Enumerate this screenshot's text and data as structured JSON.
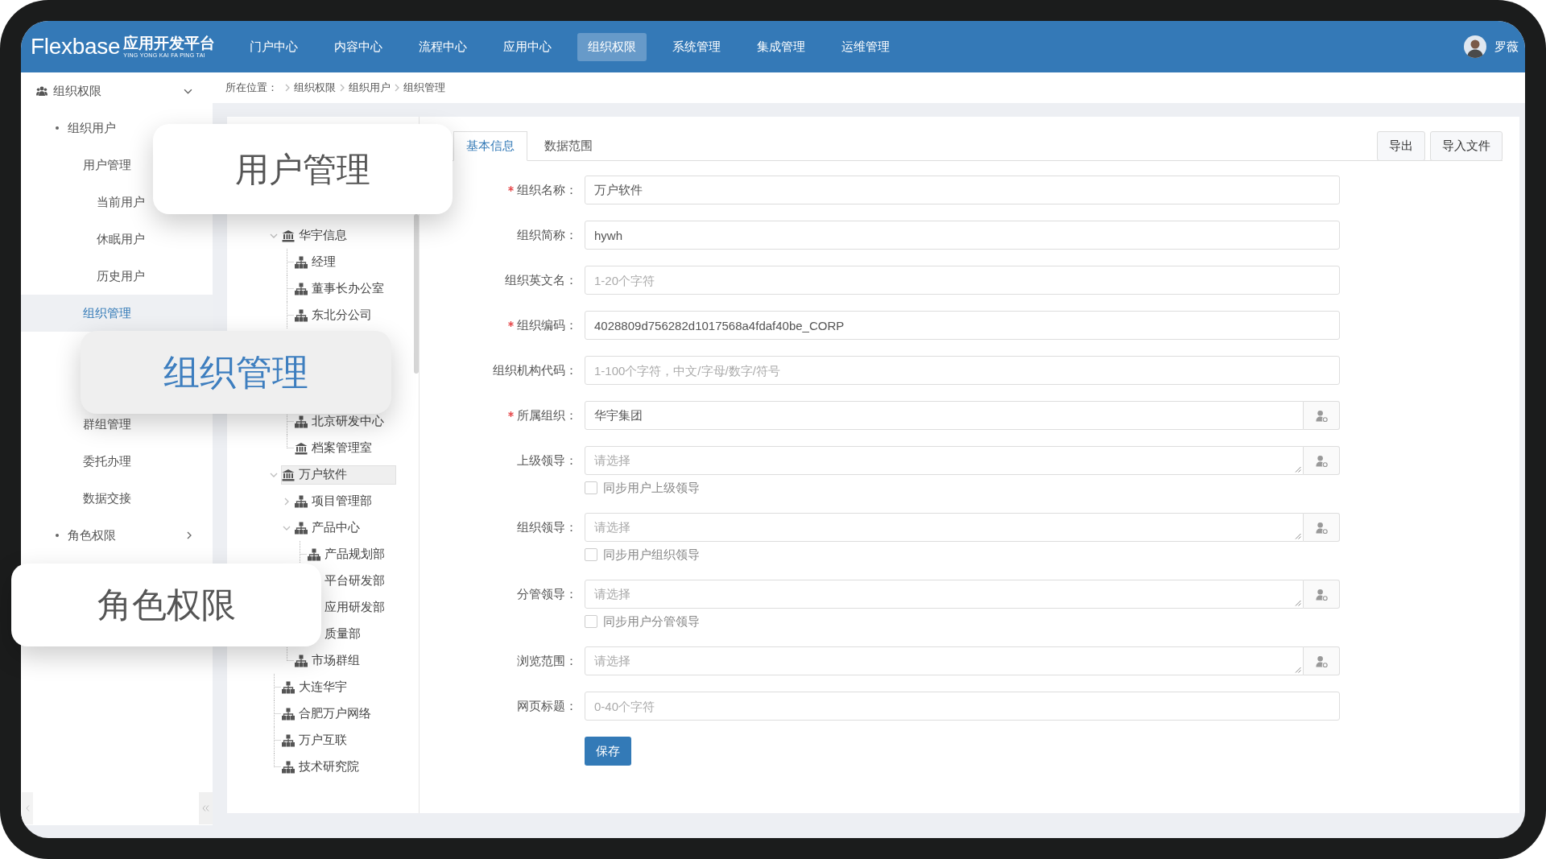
{
  "header": {
    "logo": {
      "wordmark": "Flexbase",
      "title": "应用开发平台",
      "subtitle": "YING YONG KAI FA PING TAI"
    },
    "nav": [
      {
        "label": "门户中心",
        "selected": false
      },
      {
        "label": "内容中心",
        "selected": false
      },
      {
        "label": "流程中心",
        "selected": false
      },
      {
        "label": "应用中心",
        "selected": false
      },
      {
        "label": "组织权限",
        "selected": true
      },
      {
        "label": "系统管理",
        "selected": false
      },
      {
        "label": "集成管理",
        "selected": false
      },
      {
        "label": "运维管理",
        "selected": false
      }
    ],
    "user": {
      "name": "罗薇"
    }
  },
  "sidebar": {
    "title": "组织权限",
    "items": [
      {
        "label": "组织用户",
        "expanded": true,
        "selected": false,
        "children": [
          {
            "label": "用户管理",
            "expanded": true,
            "selected": false,
            "children": [
              {
                "label": "当前用户",
                "selected": false
              },
              {
                "label": "休眠用户",
                "selected": false
              },
              {
                "label": "历史用户",
                "selected": false
              }
            ]
          },
          {
            "label": "组织管理",
            "selected": true
          },
          {
            "label": "群组管理",
            "selected": false
          },
          {
            "label": "委托办理",
            "selected": false
          },
          {
            "label": "数据交接",
            "selected": false
          }
        ]
      },
      {
        "label": "角色权限",
        "expanded": false,
        "selected": false
      }
    ]
  },
  "breadcrumb": {
    "label": "所在位置：",
    "items": [
      "组织权限",
      "组织用户",
      "组织管理"
    ]
  },
  "tree": {
    "nodes": [
      {
        "label": "华宇信息",
        "kind": "company",
        "expanded": true,
        "selected": false,
        "children": [
          {
            "label": "经理",
            "kind": "department",
            "selected": false
          },
          {
            "label": "董事长办公室",
            "kind": "department",
            "selected": false
          },
          {
            "label": "东北分公司",
            "kind": "department",
            "selected": false
          },
          {
            "label": "北京研发中心",
            "kind": "department",
            "selected": false
          },
          {
            "label": "档案管理室",
            "kind": "company",
            "selected": false
          }
        ]
      },
      {
        "label": "万户软件",
        "kind": "company",
        "expanded": true,
        "selected": true,
        "children": [
          {
            "label": "项目管理部",
            "kind": "department",
            "expanded": false,
            "selected": false
          },
          {
            "label": "产品中心",
            "kind": "department",
            "expanded": true,
            "selected": false,
            "children": [
              {
                "label": "产品规划部",
                "kind": "department",
                "selected": false
              },
              {
                "label": "平台研发部",
                "selected": false
              },
              {
                "label": "应用研发部",
                "selected": false
              },
              {
                "label": "质量部",
                "selected": false
              }
            ]
          },
          {
            "label": "市场群组",
            "kind": "department",
            "selected": false
          }
        ]
      },
      {
        "label": "大连华宇",
        "kind": "department",
        "selected": false
      },
      {
        "label": "合肥万户网络",
        "kind": "department",
        "selected": false
      },
      {
        "label": "万户互联",
        "kind": "department",
        "selected": false
      },
      {
        "label": "技术研究院",
        "kind": "department",
        "selected": false
      }
    ]
  },
  "tabs": [
    {
      "label": "基本信息",
      "selected": true
    },
    {
      "label": "数据范围",
      "selected": false
    }
  ],
  "toolbar_buttons": [
    "导出",
    "导入文件"
  ],
  "form": {
    "fields": [
      {
        "kind": "input",
        "label": "组织名称：",
        "required": true,
        "value": "万户软件"
      },
      {
        "kind": "input",
        "label": "组织简称：",
        "required": false,
        "value": "hywh"
      },
      {
        "kind": "input",
        "label": "组织英文名：",
        "required": false,
        "placeholder": "1-20个字符"
      },
      {
        "kind": "input",
        "label": "组织编码：",
        "required": true,
        "value": "4028809d756282d1017568a4fdaf40be_CORP"
      },
      {
        "kind": "input",
        "label": "组织机构代码：",
        "required": false,
        "placeholder": "1-100个字符，中文/字母/数字/符号"
      },
      {
        "kind": "picker",
        "label": "所属组织：",
        "required": true,
        "value": "华宇集团"
      },
      {
        "kind": "multi-picker",
        "label": "上级领导：",
        "required": false,
        "placeholder": "请选择",
        "sync": {
          "label": "同步用户上级领导",
          "checked": false
        }
      },
      {
        "kind": "multi-picker",
        "label": "组织领导：",
        "required": false,
        "placeholder": "请选择",
        "sync": {
          "label": "同步用户组织领导",
          "checked": false
        }
      },
      {
        "kind": "multi-picker",
        "label": "分管领导：",
        "required": false,
        "placeholder": "请选择",
        "sync": {
          "label": "同步用户分管领导",
          "checked": false
        }
      },
      {
        "kind": "multi-picker",
        "label": "浏览范围：",
        "required": false,
        "placeholder": "请选择"
      },
      {
        "kind": "input",
        "label": "网页标题：",
        "required": false,
        "placeholder": "0-40个字符"
      }
    ],
    "submit": "保存"
  },
  "callouts": [
    {
      "label": "用户管理",
      "selected": false
    },
    {
      "label": "组织管理",
      "selected": true
    },
    {
      "label": "角色权限",
      "selected": false
    }
  ]
}
